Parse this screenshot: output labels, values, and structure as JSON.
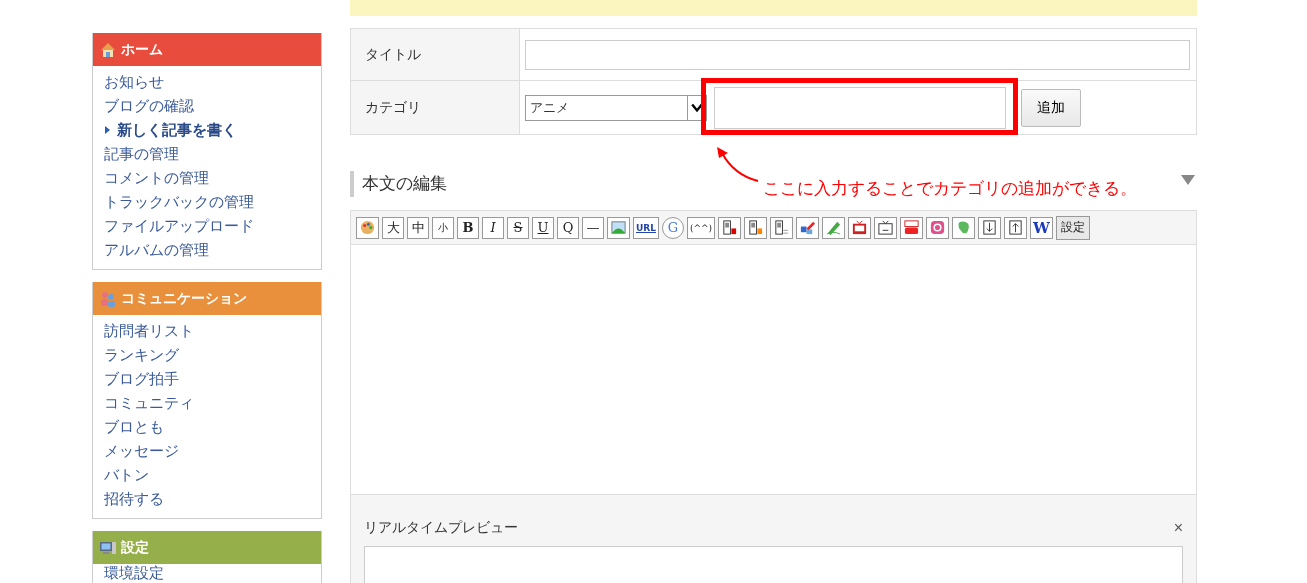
{
  "sidebar": {
    "sections": [
      {
        "title": "ホーム",
        "color": "#e74c3c",
        "items": [
          {
            "label": "お知らせ",
            "selected": false
          },
          {
            "label": "ブログの確認",
            "selected": false
          },
          {
            "label": "新しく記事を書く",
            "selected": true
          },
          {
            "label": "記事の管理",
            "selected": false
          },
          {
            "label": "コメントの管理",
            "selected": false
          },
          {
            "label": "トラックバックの管理",
            "selected": false
          },
          {
            "label": "ファイルアップロード",
            "selected": false
          },
          {
            "label": "アルバムの管理",
            "selected": false
          }
        ]
      },
      {
        "title": "コミュニケーション",
        "color": "#e8903c",
        "items": [
          {
            "label": "訪問者リスト",
            "selected": false
          },
          {
            "label": "ランキング",
            "selected": false
          },
          {
            "label": "ブログ拍手",
            "selected": false
          },
          {
            "label": "コミュニティ",
            "selected": false
          },
          {
            "label": "ブロとも",
            "selected": false
          },
          {
            "label": "メッセージ",
            "selected": false
          },
          {
            "label": "バトン",
            "selected": false
          },
          {
            "label": "招待する",
            "selected": false
          }
        ]
      },
      {
        "title": "設定",
        "color": "#95b04a",
        "items": [
          {
            "label": "環境設定",
            "selected": false
          }
        ]
      }
    ]
  },
  "form": {
    "rows": [
      {
        "kind": "text",
        "label": "タイトル"
      },
      {
        "kind": "category",
        "label": "カテゴリ",
        "select_value": "アニメ",
        "button": "追加"
      }
    ]
  },
  "editor": {
    "heading": "本文の編集",
    "toolbar": [
      {
        "kind": "icon"
      },
      {
        "kind": "text",
        "label": "大"
      },
      {
        "kind": "text",
        "label": "中"
      },
      {
        "kind": "text",
        "label": "小"
      },
      {
        "kind": "text",
        "label": "B"
      },
      {
        "kind": "text",
        "label": "I"
      },
      {
        "kind": "text",
        "label": "S"
      },
      {
        "kind": "text",
        "label": "U"
      },
      {
        "kind": "text",
        "label": "Q"
      },
      {
        "kind": "text",
        "label": "—"
      },
      {
        "kind": "icon"
      },
      {
        "kind": "text",
        "label": "URL"
      },
      {
        "kind": "text",
        "label": "G"
      },
      {
        "kind": "text",
        "label": "(^^)"
      },
      {
        "kind": "icon"
      },
      {
        "kind": "icon"
      },
      {
        "kind": "icon"
      },
      {
        "kind": "icon"
      },
      {
        "kind": "icon"
      },
      {
        "kind": "icon"
      },
      {
        "kind": "icon"
      },
      {
        "kind": "icon"
      },
      {
        "kind": "icon"
      },
      {
        "kind": "icon"
      },
      {
        "kind": "icon"
      },
      {
        "kind": "icon"
      },
      {
        "kind": "text",
        "label": "W"
      },
      {
        "kind": "setting",
        "label": "設定"
      }
    ],
    "preview": {
      "label": "リアルタイムプレビュー",
      "close": "×"
    }
  },
  "annotation": {
    "text": "ここに入力することでカテゴリの追加ができる。"
  }
}
